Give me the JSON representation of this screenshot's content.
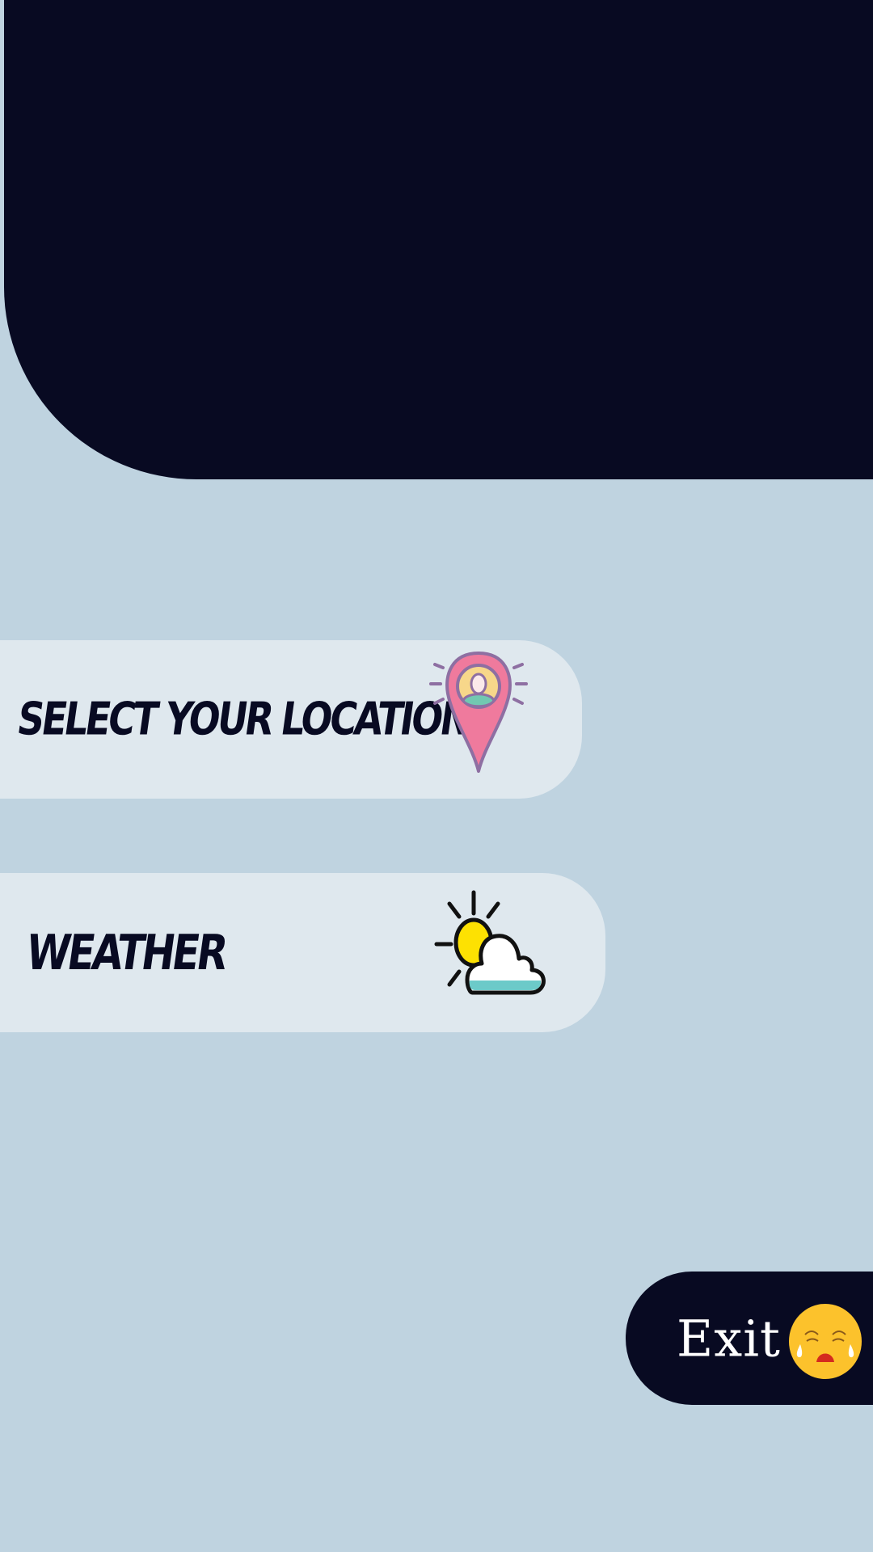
{
  "header": {
    "background_color": "#080a22"
  },
  "menu": {
    "location": {
      "label": "SELECT YOUR LOCATION",
      "icon": "location-pin-person-icon"
    },
    "weather": {
      "label": "WEATHER",
      "icon": "sun-cloud-icon"
    }
  },
  "exit": {
    "label": "Exit",
    "icon": "crying-face-icon"
  },
  "colors": {
    "background": "#bfd3e0",
    "card": "#dfe8ee",
    "dark": "#080a22",
    "pin": "#ef7a9d",
    "sun": "#fde102",
    "cloud_base": "#6ccac9",
    "face": "#fcc22c"
  }
}
